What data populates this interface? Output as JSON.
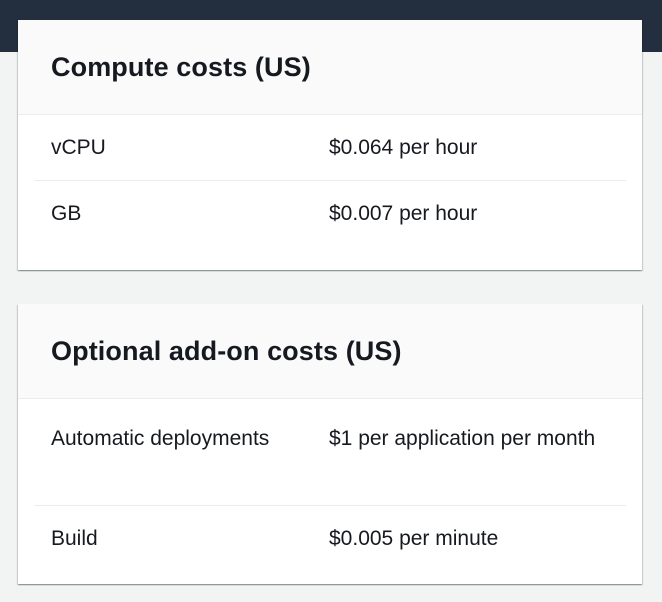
{
  "compute": {
    "title": "Compute costs (US)",
    "rows": [
      {
        "label": "vCPU",
        "value": "$0.064 per hour"
      },
      {
        "label": "GB",
        "value": "$0.007 per hour"
      }
    ]
  },
  "addons": {
    "title": "Optional add-on costs (US)",
    "rows": [
      {
        "label": "Automatic deployments",
        "value": "$1 per application per month"
      },
      {
        "label": "Build",
        "value": "$0.005 per minute"
      }
    ]
  },
  "colors": {
    "top_bar": "#232f3e",
    "page_background": "#f2f3f3",
    "card_header": "#fafafa"
  }
}
